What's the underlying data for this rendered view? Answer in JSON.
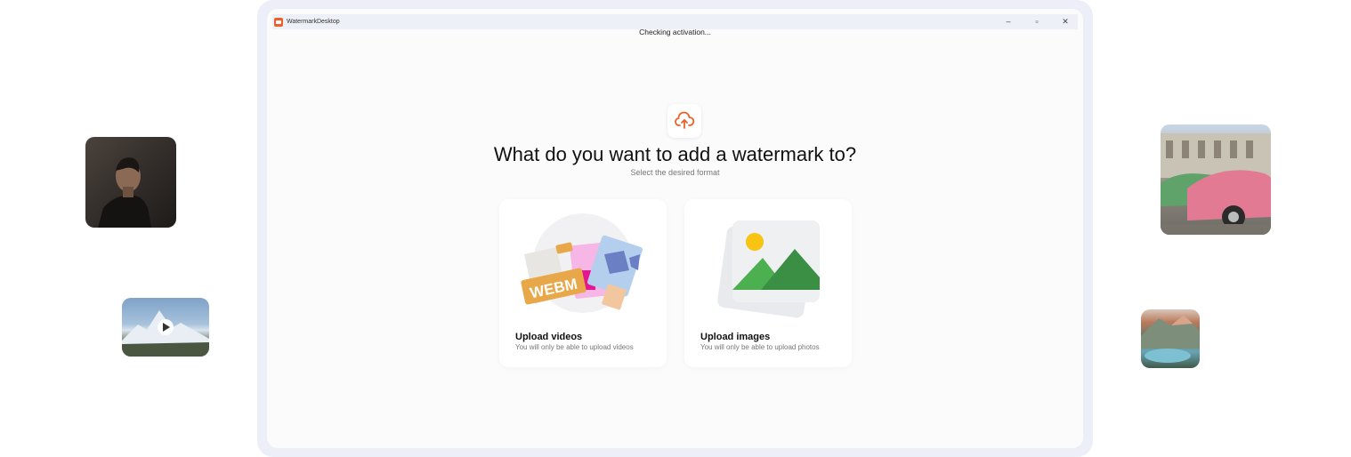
{
  "window": {
    "app_title": "WatermarkDesktop",
    "minimize_glyph": "–",
    "maximize_glyph": "▫",
    "close_glyph": "✕"
  },
  "status": {
    "text": "Checking activation..."
  },
  "main": {
    "upload_icon": "cloud-upload-icon",
    "headline": "What do you want to add a watermark to?",
    "subheadline": "Select the desired format"
  },
  "cards": [
    {
      "title": "Upload videos",
      "subtitle": "You will only be able to upload videos",
      "art_text": "WEBM"
    },
    {
      "title": "Upload images",
      "subtitle": "You will only be able to upload photos"
    }
  ],
  "colors": {
    "accent": "#e8612a",
    "frame": "#eceef8",
    "window_bg": "#fbfbfb",
    "mountain_green_dark": "#3a8f45",
    "mountain_green_light": "#4caf50",
    "sun_yellow": "#f9c312"
  }
}
